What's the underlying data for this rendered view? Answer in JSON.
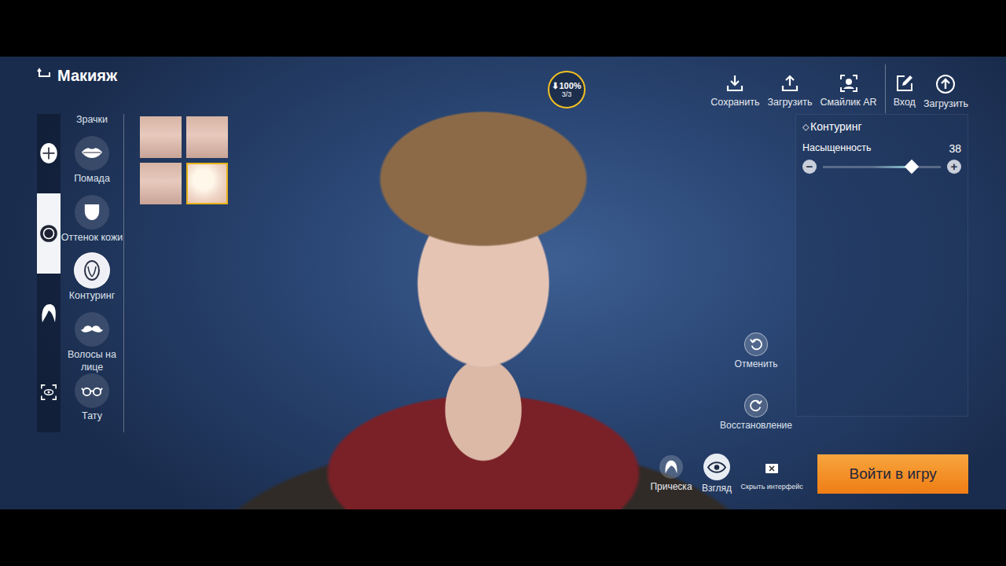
{
  "header": {
    "title": "Макияж"
  },
  "side_tabs": [
    {
      "selected": false
    },
    {
      "selected": true
    },
    {
      "selected": false
    },
    {
      "selected": false
    }
  ],
  "categories": {
    "scrolled_label": "Зрачки",
    "items": [
      {
        "label": "Помада",
        "selected": false
      },
      {
        "label": "Оттенок кожи",
        "selected": false
      },
      {
        "label": "Контуринг",
        "selected": true
      },
      {
        "label": "Волосы на лице",
        "selected": false
      },
      {
        "label": "Тату",
        "selected": false
      }
    ]
  },
  "presets": [
    {
      "selected": false
    },
    {
      "selected": false
    },
    {
      "selected": false
    },
    {
      "selected": true
    }
  ],
  "download": {
    "label": "⬇100%",
    "count": "3/3"
  },
  "toolbar": {
    "left": [
      {
        "label": "Сохранить"
      },
      {
        "label": "Загрузить"
      },
      {
        "label": "Смайлик AR"
      }
    ],
    "right": [
      {
        "label": "Вход"
      },
      {
        "label": "Загрузить"
      }
    ]
  },
  "panel": {
    "marker": "◇",
    "title": "Контуринг",
    "slider": {
      "label": "Насыщенность",
      "value": "38",
      "level": 0.75,
      "minus": "−",
      "plus": "+"
    }
  },
  "edit_actions": [
    {
      "label": "Отменить"
    },
    {
      "label": "Восстановление"
    }
  ],
  "view_buttons": [
    {
      "label": "Прическа"
    },
    {
      "label": "Взгляд"
    },
    {
      "label": "Скрыть интерфейс"
    }
  ],
  "enter_button": "Войти в игру"
}
